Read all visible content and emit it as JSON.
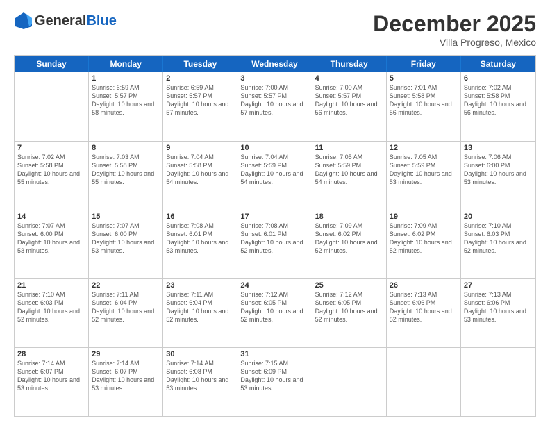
{
  "header": {
    "logo_general": "General",
    "logo_blue": "Blue",
    "month_title": "December 2025",
    "subtitle": "Villa Progreso, Mexico"
  },
  "weekdays": [
    "Sunday",
    "Monday",
    "Tuesday",
    "Wednesday",
    "Thursday",
    "Friday",
    "Saturday"
  ],
  "rows": [
    [
      {
        "day": "",
        "empty": true
      },
      {
        "day": "1",
        "sunrise": "6:59 AM",
        "sunset": "5:57 PM",
        "daylight": "10 hours and 58 minutes."
      },
      {
        "day": "2",
        "sunrise": "6:59 AM",
        "sunset": "5:57 PM",
        "daylight": "10 hours and 57 minutes."
      },
      {
        "day": "3",
        "sunrise": "7:00 AM",
        "sunset": "5:57 PM",
        "daylight": "10 hours and 57 minutes."
      },
      {
        "day": "4",
        "sunrise": "7:00 AM",
        "sunset": "5:57 PM",
        "daylight": "10 hours and 56 minutes."
      },
      {
        "day": "5",
        "sunrise": "7:01 AM",
        "sunset": "5:58 PM",
        "daylight": "10 hours and 56 minutes."
      },
      {
        "day": "6",
        "sunrise": "7:02 AM",
        "sunset": "5:58 PM",
        "daylight": "10 hours and 56 minutes."
      }
    ],
    [
      {
        "day": "7",
        "sunrise": "7:02 AM",
        "sunset": "5:58 PM",
        "daylight": "10 hours and 55 minutes."
      },
      {
        "day": "8",
        "sunrise": "7:03 AM",
        "sunset": "5:58 PM",
        "daylight": "10 hours and 55 minutes."
      },
      {
        "day": "9",
        "sunrise": "7:04 AM",
        "sunset": "5:58 PM",
        "daylight": "10 hours and 54 minutes."
      },
      {
        "day": "10",
        "sunrise": "7:04 AM",
        "sunset": "5:59 PM",
        "daylight": "10 hours and 54 minutes."
      },
      {
        "day": "11",
        "sunrise": "7:05 AM",
        "sunset": "5:59 PM",
        "daylight": "10 hours and 54 minutes."
      },
      {
        "day": "12",
        "sunrise": "7:05 AM",
        "sunset": "5:59 PM",
        "daylight": "10 hours and 53 minutes."
      },
      {
        "day": "13",
        "sunrise": "7:06 AM",
        "sunset": "6:00 PM",
        "daylight": "10 hours and 53 minutes."
      }
    ],
    [
      {
        "day": "14",
        "sunrise": "7:07 AM",
        "sunset": "6:00 PM",
        "daylight": "10 hours and 53 minutes."
      },
      {
        "day": "15",
        "sunrise": "7:07 AM",
        "sunset": "6:00 PM",
        "daylight": "10 hours and 53 minutes."
      },
      {
        "day": "16",
        "sunrise": "7:08 AM",
        "sunset": "6:01 PM",
        "daylight": "10 hours and 53 minutes."
      },
      {
        "day": "17",
        "sunrise": "7:08 AM",
        "sunset": "6:01 PM",
        "daylight": "10 hours and 52 minutes."
      },
      {
        "day": "18",
        "sunrise": "7:09 AM",
        "sunset": "6:02 PM",
        "daylight": "10 hours and 52 minutes."
      },
      {
        "day": "19",
        "sunrise": "7:09 AM",
        "sunset": "6:02 PM",
        "daylight": "10 hours and 52 minutes."
      },
      {
        "day": "20",
        "sunrise": "7:10 AM",
        "sunset": "6:03 PM",
        "daylight": "10 hours and 52 minutes."
      }
    ],
    [
      {
        "day": "21",
        "sunrise": "7:10 AM",
        "sunset": "6:03 PM",
        "daylight": "10 hours and 52 minutes."
      },
      {
        "day": "22",
        "sunrise": "7:11 AM",
        "sunset": "6:04 PM",
        "daylight": "10 hours and 52 minutes."
      },
      {
        "day": "23",
        "sunrise": "7:11 AM",
        "sunset": "6:04 PM",
        "daylight": "10 hours and 52 minutes."
      },
      {
        "day": "24",
        "sunrise": "7:12 AM",
        "sunset": "6:05 PM",
        "daylight": "10 hours and 52 minutes."
      },
      {
        "day": "25",
        "sunrise": "7:12 AM",
        "sunset": "6:05 PM",
        "daylight": "10 hours and 52 minutes."
      },
      {
        "day": "26",
        "sunrise": "7:13 AM",
        "sunset": "6:06 PM",
        "daylight": "10 hours and 52 minutes."
      },
      {
        "day": "27",
        "sunrise": "7:13 AM",
        "sunset": "6:06 PM",
        "daylight": "10 hours and 53 minutes."
      }
    ],
    [
      {
        "day": "28",
        "sunrise": "7:14 AM",
        "sunset": "6:07 PM",
        "daylight": "10 hours and 53 minutes."
      },
      {
        "day": "29",
        "sunrise": "7:14 AM",
        "sunset": "6:07 PM",
        "daylight": "10 hours and 53 minutes."
      },
      {
        "day": "30",
        "sunrise": "7:14 AM",
        "sunset": "6:08 PM",
        "daylight": "10 hours and 53 minutes."
      },
      {
        "day": "31",
        "sunrise": "7:15 AM",
        "sunset": "6:09 PM",
        "daylight": "10 hours and 53 minutes."
      },
      {
        "day": "",
        "empty": true
      },
      {
        "day": "",
        "empty": true
      },
      {
        "day": "",
        "empty": true
      }
    ]
  ]
}
